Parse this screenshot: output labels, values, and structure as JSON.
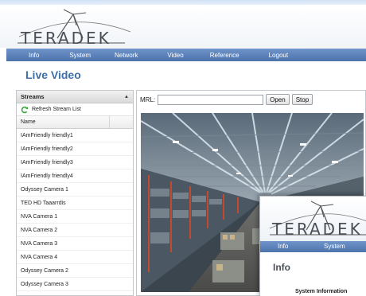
{
  "brand": {
    "logo_text": "TERADEK"
  },
  "nav": {
    "items": [
      {
        "label": "Info"
      },
      {
        "label": "System"
      },
      {
        "label": "Network"
      },
      {
        "label": "Video"
      },
      {
        "label": "Reference"
      },
      {
        "label": "Logout"
      }
    ]
  },
  "page": {
    "title": "Live Video"
  },
  "streams": {
    "title": "Streams",
    "refresh_label": "Refresh Stream List",
    "column_name": "Name",
    "items": [
      "IAmFriendly friendly1",
      "IAmFriendly friendly2",
      "IAmFriendly friendly3",
      "IAmFriendly friendly4",
      "Odyssey Camera 1",
      "TED HD Taaarrdis",
      "NVA Camera 1",
      "NVA Camera 2",
      "NVA Camera 3",
      "NVA Camera 4",
      "Odyssey Camera 2",
      "Odyssey Camera 3"
    ]
  },
  "player": {
    "mrl_label": "MRL:",
    "mrl_value": "",
    "open_label": "Open",
    "stop_label": "Stop"
  },
  "overlay": {
    "logo_text": "TERADEK",
    "nav_items": [
      "Info",
      "System"
    ],
    "title": "Info",
    "section_title": "System Information"
  },
  "colors": {
    "nav_bar": "#5a7fb8",
    "title_blue": "#3d6fa8",
    "refresh_green": "#3aa43a"
  }
}
